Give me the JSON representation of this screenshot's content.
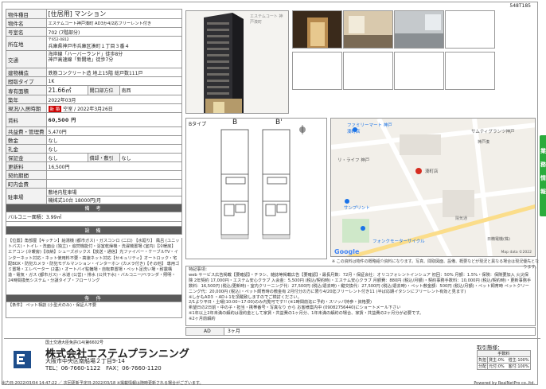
{
  "property_id": "548T185",
  "info": {
    "type_label": "物件種目",
    "type_value": "[住居用] マンション",
    "name_label": "物件名",
    "name_value": "エステムコート神戸湊町 AD3か4/2応フリーレント付き",
    "room_label": "号室名",
    "room_value": "702 (7階部分)",
    "address_label": "所在地",
    "address_zip": "〒652-0812",
    "address_value": "兵庫県神戸市兵庫区湊町１丁目３番４",
    "transport_label": "交通",
    "transport_1": "海岸線「ハーバーランド」徒歩8分",
    "transport_2": "神戸高速線「新開地」徒歩7分",
    "structure_label": "建物構造",
    "structure_value": "鉄筋コンクリート造 地上15階 総戸数111戸",
    "layout_label": "間取タイプ",
    "layout_value": "1K",
    "area_label": "専有面積",
    "area_value": "21.66㎡",
    "opening_label": "開口部方位",
    "opening_value": "南西",
    "built_label": "築年",
    "built_value": "2022年03月",
    "status_label": "現況/入居時期",
    "status_tag": "新 築",
    "status_value": "空室 / 2022年3月26日",
    "rent_label": "賃料",
    "rent_value": "60,500 円",
    "fee_label": "共益費・管理費",
    "fee_value": "5,470円",
    "shikikin_label": "敷金",
    "shikikin_value": "なし",
    "reikin_label": "礼金",
    "reikin_value": "なし",
    "hoshokin_label": "保証金",
    "hoshokin_value": "なし",
    "amortization_label": "償却・敷引",
    "amortization_value": "なし",
    "renewal_label": "更新料",
    "renewal_value": "16,500円",
    "contract_label": "契約期間",
    "contract_value": "",
    "association_label": "町内会費",
    "association_value": "",
    "parking_label": "駐車場",
    "parking_line1": "敷地内駐車場",
    "parking_line2": "機械式10台 18000円/月",
    "remarks_header": "備 考",
    "balcony": "バルコニー面積：3.99㎡",
    "equipment_header": "設 備",
    "equipment_text": "【位置】角部屋【キッチン】給湯機 (都市ガス)・ガスコンロ (二口) 【水廻り】 風呂 (ユニットバス)・トイレ・洗面台 (独立)・追焚機能付・浴室乾燥機・洗濯機置場 (室内)【冷暖房】 エアコン (冷暖房)【収納】シューズボックス【放送・通信】光ファイバー・ケーブルTV・インターネット対応・ネット使用料不要・高速ネット対応【セキュリティ】オートロック・宅配BOX・防犯カメラ・防犯モデルマンション・インターホン (カメラ付き)【その他】 専用ゴミ置場・エレベーター (2基)・オートバイ駐輪場・自転車置場・ペット足洗い場・耐震構造・電気・ガス (都市ガス)・水道 (公営)・排水 (公共下水)・バルコニー/ベランダ・照明・24時間換気システム・分譲タイプ・フローリング",
    "conditions_header": "条 件",
    "conditions_text": "【条件】 ペット相談 (小型犬のみ)・保証人不要"
  },
  "building_sign": "エステムコート 神戸湊町",
  "floorplan": {
    "type_label": "Bタイプ",
    "plan_b": "B",
    "plan_b_prime": "B'"
  },
  "map": {
    "labels": [
      "ファミリーマート 神戸湊町店",
      "サムティグランツ神戸",
      "神戸湊",
      "リ・ライフ 神戸",
      "湊町店",
      "サンプリント",
      "フォンクモーターサイクル",
      "日精電機(株)",
      "陽気通"
    ],
    "google": "Google",
    "copyright": "Map data ©2022",
    "note": "※ この資料は物件の概略紹介資料になります。写真、間取図面、設備、概要などが現況と異なる場合は現況優先となります。"
  },
  "remarks": {
    "title": "特記事項：",
    "text": "web サービス広告掲載【要確認】・チラシ、雑誌等掲載広告【要確認】・最長月数：72月・保証会社：オリコフォレントインシュア 初回：50% 月額：1.5%・保険：保険要加入 火災保険 2年契約 17,000円・エステム安心クラブ 入会金：5,500円 (税込/契約時)・エステム安心クラブ 月額費：880円 (税込/月額)・契約事務手数料：10,000円 (税込/契約時)・更新事務手数料：16,500円 (税込/更新時)・室内クリーニング代：27,500円 (税込/退去時)・鍵交換代：27,500円 (税込/退去時)・ペット敷金額：500円 (税込/月額)・ペット飼育時 ペットクリーニング代：20,000円 (税込)・ペット飼育時の敷金有 2月付分の方に限り4/20迄フリーレント付き11 (半ば応期イタシシにフリーレント有効と見ます)",
    "text2": "※しかもAD3 ・AD＋1を頂戴致しますのでご検討ください。",
    "text3": "2/1より平日・土曜(10:00~17:00)のみ内覧可です!! (※1時間前迄に予約・スリッパ持参・資格要)",
    "text4": "希望日の2日前・中の子・担当・携帯番号・写真なり から お客様案内中 (09082756440)にショートメール下さい",
    "text5": "※1年以上2年未満の解約は違約金として家賃・共益費の1ヶ月分、1年未満の解約の場合、家賃・共益費の2ヶ月分が必要です。",
    "text6": "※2ヶ月前解約"
  },
  "ad": {
    "label": "AD",
    "value": "3ヶ月"
  },
  "side_tab": [
    "業",
    "務",
    "情",
    "報"
  ],
  "company": {
    "registration": "国土交通大臣免許(14)第6602号",
    "name": "株式会社エステムプランニング",
    "address": "大阪市中央区南船場２丁目9-14",
    "phone": "TEL：06-7660-1122　FAX：06-7660-1120"
  },
  "terms": {
    "title": "取引態様：",
    "header": "手数料",
    "row1_label": "負担",
    "row1_value": "貸主:0%　借主:100%",
    "row2_label": "分配",
    "row2_value": "元付:0%　客付:100%"
  },
  "bottom": {
    "left": "出力日:2022/03/04 14:47:22 ／ 次回更新予定日:2022/03/18 ※掲載情報は随時更新される場合がございます。",
    "right": "Powered by RealNetPro co.,ltd."
  },
  "colors": {
    "accent_green": "#2bab3c",
    "section_gray": "#5a5a5a",
    "new_red": "#cc0000",
    "map_pin": "#d62d20"
  }
}
